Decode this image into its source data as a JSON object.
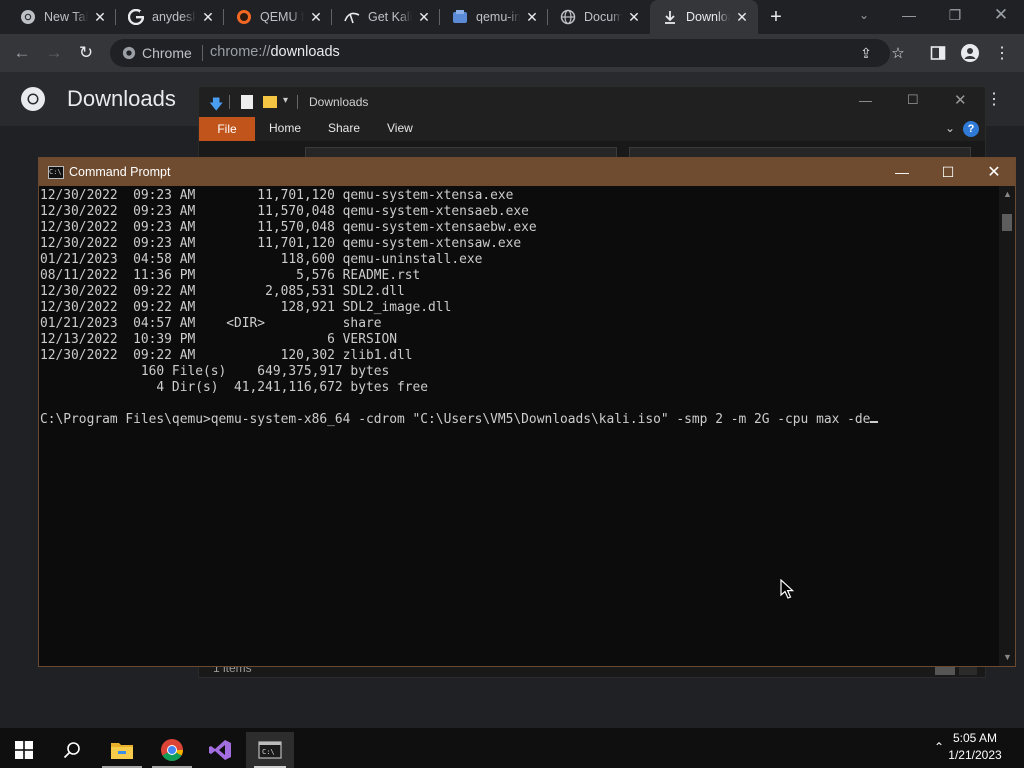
{
  "browser": {
    "tabs": [
      {
        "label": "New Tab",
        "icon": "chrome-icon"
      },
      {
        "label": "anydesk",
        "icon": "google-icon"
      },
      {
        "label": "QEMU for Windows",
        "icon": "qemu-icon"
      },
      {
        "label": "Get Kali",
        "icon": "kali-icon"
      },
      {
        "label": "qemu-img",
        "icon": "doc-icon"
      },
      {
        "label": "Documentation",
        "icon": "globe-icon"
      },
      {
        "label": "Downloads",
        "icon": "download-icon",
        "active": true
      }
    ],
    "omnibox": {
      "site": "Chrome",
      "url_scheme": "chrome://",
      "url_path": "downloads"
    }
  },
  "downloads_page": {
    "title": "Downloads"
  },
  "explorer": {
    "title": "Downloads",
    "ribbon_tabs": [
      "File",
      "Home",
      "Share",
      "View"
    ],
    "status": "1 items"
  },
  "cmd": {
    "title": "Command Prompt",
    "lines": [
      "12/30/2022  09:23 AM        11,701,120 qemu-system-xtensa.exe",
      "12/30/2022  09:23 AM        11,570,048 qemu-system-xtensaeb.exe",
      "12/30/2022  09:23 AM        11,570,048 qemu-system-xtensaebw.exe",
      "12/30/2022  09:23 AM        11,701,120 qemu-system-xtensaw.exe",
      "01/21/2023  04:58 AM           118,600 qemu-uninstall.exe",
      "08/11/2022  11:36 PM             5,576 README.rst",
      "12/30/2022  09:22 AM         2,085,531 SDL2.dll",
      "12/30/2022  09:22 AM           128,921 SDL2_image.dll",
      "01/21/2023  04:57 AM    <DIR>          share",
      "12/13/2022  10:39 PM                 6 VERSION",
      "12/30/2022  09:22 AM           120,302 zlib1.dll",
      "             160 File(s)    649,375,917 bytes",
      "               4 Dir(s)  41,241,116,672 bytes free",
      "",
      "C:\\Program Files\\qemu>qemu-system-x86_64 -cdrom \"C:\\Users\\VM5\\Downloads\\kali.iso\" -smp 2 -m 2G -cpu max -de"
    ]
  },
  "taskbar": {
    "apps": [
      "start-icon",
      "search-icon",
      "file-explorer-icon",
      "chrome-icon",
      "visual-studio-icon",
      "terminal-icon"
    ],
    "time": "5:05 AM",
    "date": "1/21/2023"
  },
  "colors": {
    "cmd_titlebar": "#6f4b2f",
    "explorer_file_tab": "#c1541b",
    "chrome_frame": "#202124",
    "chrome_toolbar": "#35363a"
  }
}
